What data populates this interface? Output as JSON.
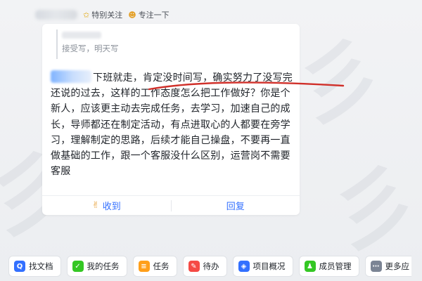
{
  "header": {
    "tags": [
      {
        "icon": "star-icon",
        "label": "特别关注"
      },
      {
        "icon": "focus-face-icon",
        "label": "专注一下"
      }
    ]
  },
  "card": {
    "quote_text": "接受写，明天写",
    "message_text": "下班就走，肯定没时间写，确实努力了没写完还说的过去，这样的工作态度怎么把工作做好？你是个新人，应该更主动去完成任务，去学习，加速自己的成长，导师都还在制定活动，有点进取心的人都要在旁学习，理解制定的思路，后续才能自己操盘，不要再一直做基础的工作，跟一个客服没什么区别，运营岗不需要客服",
    "actions": [
      {
        "icon": "ok-hand-icon",
        "label": "收到"
      },
      {
        "icon": "",
        "label": "回复"
      }
    ]
  },
  "toolbar": [
    {
      "icon": "search-doc-icon",
      "label": "找文档",
      "color": "#3370ff"
    },
    {
      "icon": "task-check-icon",
      "label": "我的任务",
      "color": "#34c724"
    },
    {
      "icon": "task-list-icon",
      "label": "任务",
      "color": "#ff9f1a"
    },
    {
      "icon": "todo-icon",
      "label": "待办",
      "color": "#f54a45"
    },
    {
      "icon": "project-overview-icon",
      "label": "项目概况",
      "color": "#3370ff"
    },
    {
      "icon": "member-manage-icon",
      "label": "成员管理",
      "color": "#34c724"
    },
    {
      "icon": "more-apps-icon",
      "label": "更多应",
      "color": "#7b8494"
    }
  ],
  "colors": {
    "accent": "#3370ff",
    "annotation_stroke": "#d0302a"
  }
}
